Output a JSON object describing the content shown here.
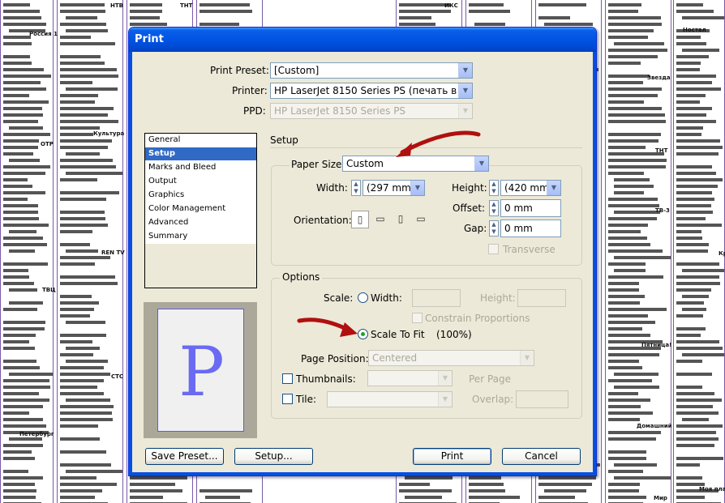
{
  "background": {
    "labels": [
      "НТВ",
      "ТНТ",
      "ИКС",
      "Россия 1",
      "Культура",
      "ОТР",
      "REN TV",
      "ТВЦ",
      "СТС",
      "Петербург",
      "Ностал",
      "Звезда",
      "ТНТ",
      "ТВ-3",
      "Кр",
      "Пятница!",
      "Домашний",
      "Мир",
      "Моя плане"
    ]
  },
  "dialog": {
    "title": "Print",
    "print_preset_label": "Print Preset:",
    "print_preset_value": "[Custom]",
    "printer_label": "Printer:",
    "printer_value": "HP LaserJet 8150 Series PS (печать в фа",
    "ppd_label": "PPD:",
    "ppd_value": "HP LaserJet 8150 Series PS",
    "nav": [
      "General",
      "Setup",
      "Marks and Bleed",
      "Output",
      "Graphics",
      "Color Management",
      "Advanced",
      "Summary"
    ],
    "nav_selected": "Setup",
    "preview_letter": "P",
    "setup": {
      "title": "Setup",
      "paper_size_label": "Paper Size:",
      "paper_size_value": "Custom",
      "width_label": "Width:",
      "width_value": "(297 mm",
      "height_label": "Height:",
      "height_value": "(420 mm",
      "offset_label": "Offset:",
      "offset_value": "0 mm",
      "gap_label": "Gap:",
      "gap_value": "0 mm",
      "orientation_label": "Orientation:",
      "transverse_label": "Transverse"
    },
    "options": {
      "title": "Options",
      "scale_label": "Scale:",
      "width_label": "Width:",
      "height_label": "Height:",
      "constrain_label": "Constrain Proportions",
      "scale_to_fit_label": "Scale To Fit",
      "scale_to_fit_value": "(100%)",
      "page_position_label": "Page Position:",
      "page_position_value": "Centered",
      "thumbnails_label": "Thumbnails:",
      "per_page_label": "Per Page",
      "tile_label": "Tile:",
      "overlap_label": "Overlap:"
    },
    "buttons": {
      "save_preset": "Save Preset...",
      "setup": "Setup...",
      "print": "Print",
      "cancel": "Cancel"
    }
  }
}
